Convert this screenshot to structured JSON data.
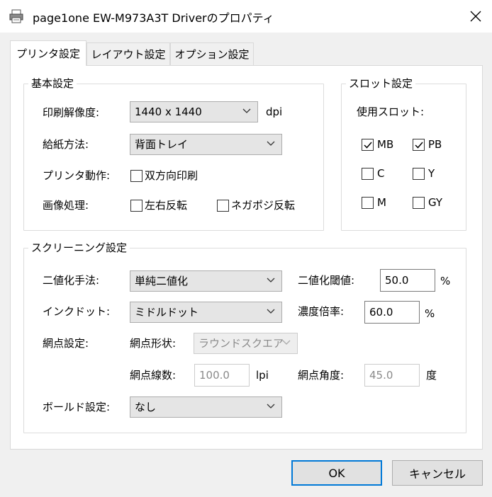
{
  "window": {
    "title": "page1one EW-M973A3T Driverのプロパティ"
  },
  "tabs": [
    {
      "label": "プリンタ設定",
      "active": true
    },
    {
      "label": "レイアウト設定",
      "active": false
    },
    {
      "label": "オプション設定",
      "active": false
    }
  ],
  "basic": {
    "title": "基本設定",
    "resolution_label": "印刷解像度:",
    "resolution_value": "1440 x 1440",
    "resolution_unit": "dpi",
    "paper_feed_label": "給紙方法:",
    "paper_feed_value": "背面トレイ",
    "printer_action_label": "プリンタ動作:",
    "duplex_label": "双方向印刷",
    "duplex_checked": false,
    "image_processing_label": "画像処理:",
    "mirror_label": "左右反転",
    "mirror_checked": false,
    "negative_label": "ネガポジ反転",
    "negative_checked": false
  },
  "slot": {
    "title": "スロット設定",
    "used_slot_label": "使用スロット:",
    "slots": [
      {
        "label": "MB",
        "checked": true
      },
      {
        "label": "PB",
        "checked": true
      },
      {
        "label": "C",
        "checked": false
      },
      {
        "label": "Y",
        "checked": false
      },
      {
        "label": "M",
        "checked": false
      },
      {
        "label": "GY",
        "checked": false
      }
    ]
  },
  "screening": {
    "title": "スクリーニング設定",
    "binarize_method_label": "二値化手法:",
    "binarize_method_value": "単純二値化",
    "threshold_label": "二値化閾値:",
    "threshold_value": "50.0",
    "threshold_unit": "%",
    "ink_dot_label": "インクドット:",
    "ink_dot_value": "ミドルドット",
    "density_label": "濃度倍率:",
    "density_value": "60.0",
    "density_unit": "%",
    "halftone_label": "網点設定:",
    "halftone_shape_label": "網点形状:",
    "halftone_shape_value": "ラウンドスクエア",
    "halftone_lines_label": "網点線数:",
    "halftone_lines_value": "100.0",
    "halftone_lines_unit": "lpi",
    "halftone_angle_label": "網点角度:",
    "halftone_angle_value": "45.0",
    "halftone_angle_unit": "度",
    "bold_label": "ボールド設定:",
    "bold_value": "なし"
  },
  "buttons": {
    "ok": "OK",
    "cancel": "キャンセル"
  },
  "colors": {
    "accent": "#0078d7",
    "window_bg": "#f0f0f0",
    "panel_bg": "#ffffff"
  }
}
